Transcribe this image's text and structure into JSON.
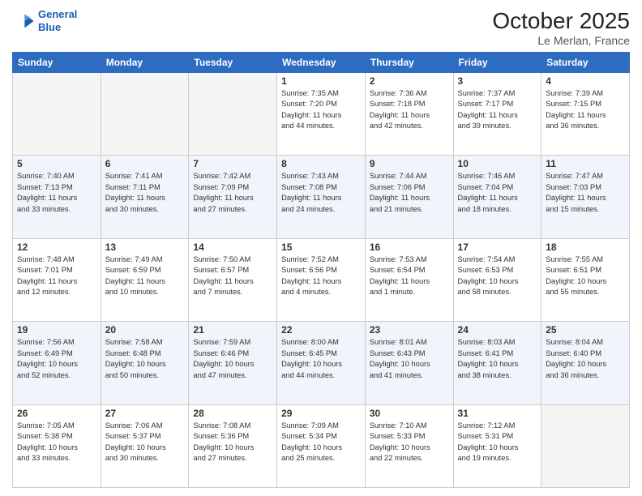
{
  "header": {
    "logo_line1": "General",
    "logo_line2": "Blue",
    "month": "October 2025",
    "location": "Le Merlan, France"
  },
  "days_of_week": [
    "Sunday",
    "Monday",
    "Tuesday",
    "Wednesday",
    "Thursday",
    "Friday",
    "Saturday"
  ],
  "weeks": [
    [
      {
        "day": "",
        "info": ""
      },
      {
        "day": "",
        "info": ""
      },
      {
        "day": "",
        "info": ""
      },
      {
        "day": "1",
        "info": "Sunrise: 7:35 AM\nSunset: 7:20 PM\nDaylight: 11 hours\nand 44 minutes."
      },
      {
        "day": "2",
        "info": "Sunrise: 7:36 AM\nSunset: 7:18 PM\nDaylight: 11 hours\nand 42 minutes."
      },
      {
        "day": "3",
        "info": "Sunrise: 7:37 AM\nSunset: 7:17 PM\nDaylight: 11 hours\nand 39 minutes."
      },
      {
        "day": "4",
        "info": "Sunrise: 7:39 AM\nSunset: 7:15 PM\nDaylight: 11 hours\nand 36 minutes."
      }
    ],
    [
      {
        "day": "5",
        "info": "Sunrise: 7:40 AM\nSunset: 7:13 PM\nDaylight: 11 hours\nand 33 minutes."
      },
      {
        "day": "6",
        "info": "Sunrise: 7:41 AM\nSunset: 7:11 PM\nDaylight: 11 hours\nand 30 minutes."
      },
      {
        "day": "7",
        "info": "Sunrise: 7:42 AM\nSunset: 7:09 PM\nDaylight: 11 hours\nand 27 minutes."
      },
      {
        "day": "8",
        "info": "Sunrise: 7:43 AM\nSunset: 7:08 PM\nDaylight: 11 hours\nand 24 minutes."
      },
      {
        "day": "9",
        "info": "Sunrise: 7:44 AM\nSunset: 7:06 PM\nDaylight: 11 hours\nand 21 minutes."
      },
      {
        "day": "10",
        "info": "Sunrise: 7:46 AM\nSunset: 7:04 PM\nDaylight: 11 hours\nand 18 minutes."
      },
      {
        "day": "11",
        "info": "Sunrise: 7:47 AM\nSunset: 7:03 PM\nDaylight: 11 hours\nand 15 minutes."
      }
    ],
    [
      {
        "day": "12",
        "info": "Sunrise: 7:48 AM\nSunset: 7:01 PM\nDaylight: 11 hours\nand 12 minutes."
      },
      {
        "day": "13",
        "info": "Sunrise: 7:49 AM\nSunset: 6:59 PM\nDaylight: 11 hours\nand 10 minutes."
      },
      {
        "day": "14",
        "info": "Sunrise: 7:50 AM\nSunset: 6:57 PM\nDaylight: 11 hours\nand 7 minutes."
      },
      {
        "day": "15",
        "info": "Sunrise: 7:52 AM\nSunset: 6:56 PM\nDaylight: 11 hours\nand 4 minutes."
      },
      {
        "day": "16",
        "info": "Sunrise: 7:53 AM\nSunset: 6:54 PM\nDaylight: 11 hours\nand 1 minute."
      },
      {
        "day": "17",
        "info": "Sunrise: 7:54 AM\nSunset: 6:53 PM\nDaylight: 10 hours\nand 58 minutes."
      },
      {
        "day": "18",
        "info": "Sunrise: 7:55 AM\nSunset: 6:51 PM\nDaylight: 10 hours\nand 55 minutes."
      }
    ],
    [
      {
        "day": "19",
        "info": "Sunrise: 7:56 AM\nSunset: 6:49 PM\nDaylight: 10 hours\nand 52 minutes."
      },
      {
        "day": "20",
        "info": "Sunrise: 7:58 AM\nSunset: 6:48 PM\nDaylight: 10 hours\nand 50 minutes."
      },
      {
        "day": "21",
        "info": "Sunrise: 7:59 AM\nSunset: 6:46 PM\nDaylight: 10 hours\nand 47 minutes."
      },
      {
        "day": "22",
        "info": "Sunrise: 8:00 AM\nSunset: 6:45 PM\nDaylight: 10 hours\nand 44 minutes."
      },
      {
        "day": "23",
        "info": "Sunrise: 8:01 AM\nSunset: 6:43 PM\nDaylight: 10 hours\nand 41 minutes."
      },
      {
        "day": "24",
        "info": "Sunrise: 8:03 AM\nSunset: 6:41 PM\nDaylight: 10 hours\nand 38 minutes."
      },
      {
        "day": "25",
        "info": "Sunrise: 8:04 AM\nSunset: 6:40 PM\nDaylight: 10 hours\nand 36 minutes."
      }
    ],
    [
      {
        "day": "26",
        "info": "Sunrise: 7:05 AM\nSunset: 5:38 PM\nDaylight: 10 hours\nand 33 minutes."
      },
      {
        "day": "27",
        "info": "Sunrise: 7:06 AM\nSunset: 5:37 PM\nDaylight: 10 hours\nand 30 minutes."
      },
      {
        "day": "28",
        "info": "Sunrise: 7:08 AM\nSunset: 5:36 PM\nDaylight: 10 hours\nand 27 minutes."
      },
      {
        "day": "29",
        "info": "Sunrise: 7:09 AM\nSunset: 5:34 PM\nDaylight: 10 hours\nand 25 minutes."
      },
      {
        "day": "30",
        "info": "Sunrise: 7:10 AM\nSunset: 5:33 PM\nDaylight: 10 hours\nand 22 minutes."
      },
      {
        "day": "31",
        "info": "Sunrise: 7:12 AM\nSunset: 5:31 PM\nDaylight: 10 hours\nand 19 minutes."
      },
      {
        "day": "",
        "info": ""
      }
    ]
  ]
}
